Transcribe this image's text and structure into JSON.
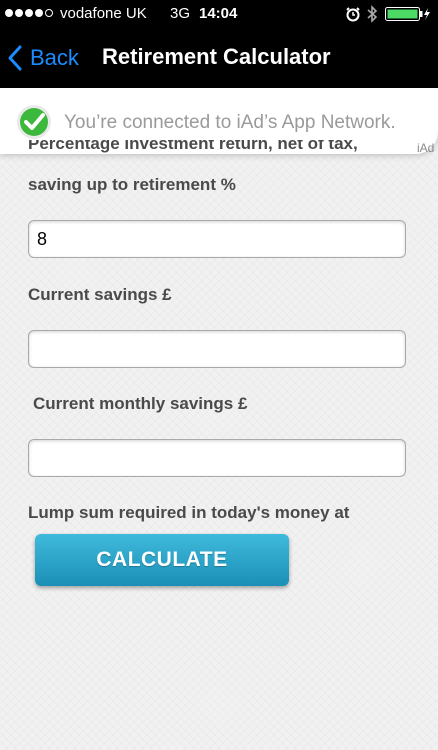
{
  "status_bar": {
    "carrier": "vodafone UK",
    "network": "3G",
    "time": "14:04",
    "signal_bars": 4,
    "signal_total": 5,
    "icons": [
      "alarm-icon",
      "bluetooth-icon",
      "battery-charging-icon"
    ]
  },
  "nav": {
    "back_label": "Back",
    "title": "Retirement Calculator"
  },
  "iad": {
    "message": "You’re connected to iAd’s App Network.",
    "tag": "iAd"
  },
  "form": {
    "return_label_line1": "Percentage investment return, net of tax,",
    "return_label_line2": "saving up to retirement %",
    "return_value": "8",
    "current_savings_label": "Current savings £",
    "current_savings_value": "",
    "monthly_savings_label": "Current monthly savings £",
    "monthly_savings_value": "",
    "lump_sum_label": "Lump sum required in today's money at",
    "calculate_label": "CALCULATE"
  },
  "colors": {
    "accent": "#1a8cff",
    "button": "#2aa6cc",
    "check": "#3cb83c"
  }
}
